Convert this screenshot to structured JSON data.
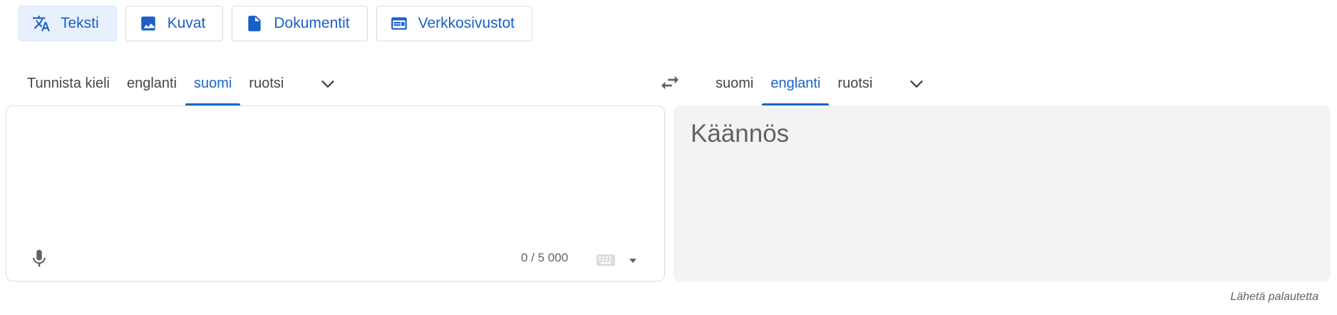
{
  "modes": [
    {
      "label": "Teksti",
      "icon": "translate-icon",
      "active": true
    },
    {
      "label": "Kuvat",
      "icon": "image-icon",
      "active": false
    },
    {
      "label": "Dokumentit",
      "icon": "document-icon",
      "active": false
    },
    {
      "label": "Verkkosivustot",
      "icon": "website-icon",
      "active": false
    }
  ],
  "source_langs": {
    "detect": "Tunnista kieli",
    "items": [
      "englanti",
      "suomi",
      "ruotsi"
    ],
    "active": "suomi"
  },
  "target_langs": {
    "items": [
      "suomi",
      "englanti",
      "ruotsi"
    ],
    "active": "englanti"
  },
  "source": {
    "value": "",
    "counter": "0 / 5 000"
  },
  "target": {
    "placeholder": "Käännös"
  },
  "feedback_label": "Lähetä palautetta",
  "colors": {
    "accent": "#1a66c8",
    "active_chip_bg": "#e8f0fe",
    "target_bg": "#f3f3f3"
  }
}
